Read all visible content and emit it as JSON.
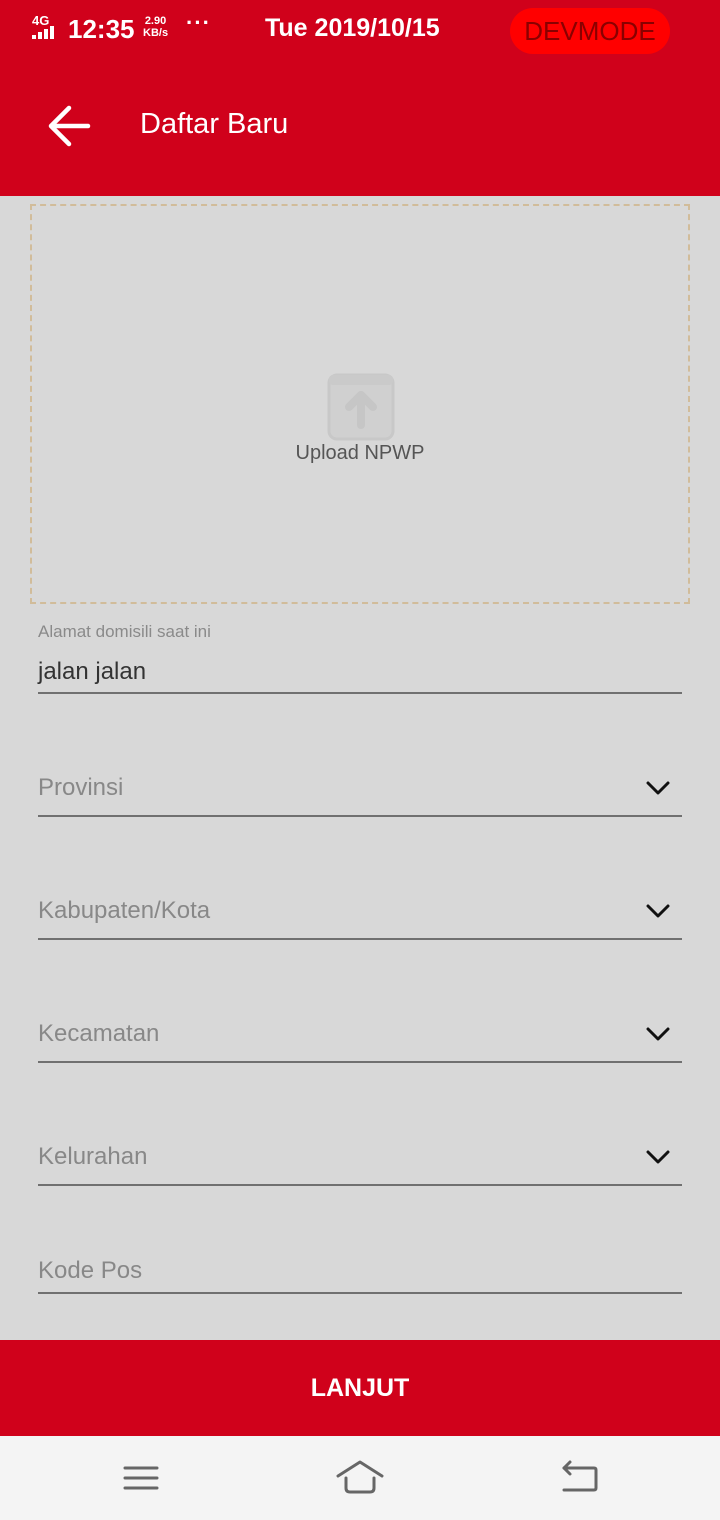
{
  "status_bar": {
    "network": "4G",
    "time": "12:35",
    "speed_value": "2.90",
    "speed_unit": "KB/s",
    "more": "···",
    "date": "Tue 2019/10/15",
    "badge": "DEVMODE"
  },
  "header": {
    "title": "Daftar Baru",
    "back_icon": "arrow-left-icon",
    "color": "#d0011b"
  },
  "upload": {
    "label": "Upload NPWP",
    "icon": "upload-icon"
  },
  "form": {
    "address": {
      "label": "Alamat domisili saat ini",
      "value": "jalan jalan"
    },
    "province": {
      "placeholder": "Provinsi"
    },
    "city": {
      "placeholder": "Kabupaten/Kota"
    },
    "district": {
      "placeholder": "Kecamatan"
    },
    "subdistrict": {
      "placeholder": "Kelurahan"
    },
    "postal_code": {
      "placeholder": "Kode Pos"
    }
  },
  "actions": {
    "next_label": "LANJUT"
  },
  "system_nav": {
    "menu_icon": "menu-icon",
    "home_icon": "home-icon",
    "back_icon": "back-icon"
  }
}
